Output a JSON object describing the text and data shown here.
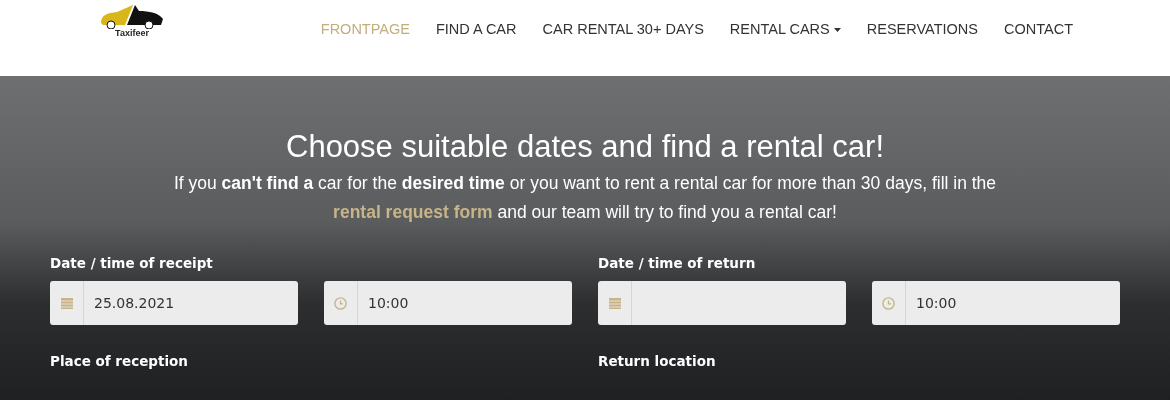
{
  "logo": {
    "text": "Taxifeer"
  },
  "nav": [
    {
      "label": "FRONTPAGE",
      "selected": true,
      "kind": "link"
    },
    {
      "label": "FIND A CAR",
      "selected": false,
      "kind": "link"
    },
    {
      "label": "CAR RENTAL 30+ DAYS",
      "selected": false,
      "kind": "link"
    },
    {
      "label": "RENTAL CARS",
      "selected": false,
      "kind": "dropdown"
    },
    {
      "label": "RESERVATIONS",
      "selected": false,
      "kind": "link"
    },
    {
      "label": "CONTACT",
      "selected": false,
      "kind": "link"
    }
  ],
  "hero": {
    "title": "Choose suitable dates and find a rental car!",
    "text_before": "If you **can't find a**  car for the **desired time** or you want to rent a rental car for more than 30 days, fill in the",
    "link": "rental request form",
    "text_after": " and our team will try to find you a rental car!"
  },
  "groups": [
    {
      "label": "Date / time of receipt",
      "fields": [
        {
          "kind": "date",
          "value": "25.08.2021"
        },
        {
          "kind": "time",
          "value": "10:00"
        }
      ]
    },
    {
      "label": "Date / time of return",
      "fields": [
        {
          "kind": "date"
        },
        {
          "kind": "time",
          "value": "10:00"
        }
      ]
    }
  ],
  "location_labels": [
    "Place of reception",
    "Return location"
  ]
}
